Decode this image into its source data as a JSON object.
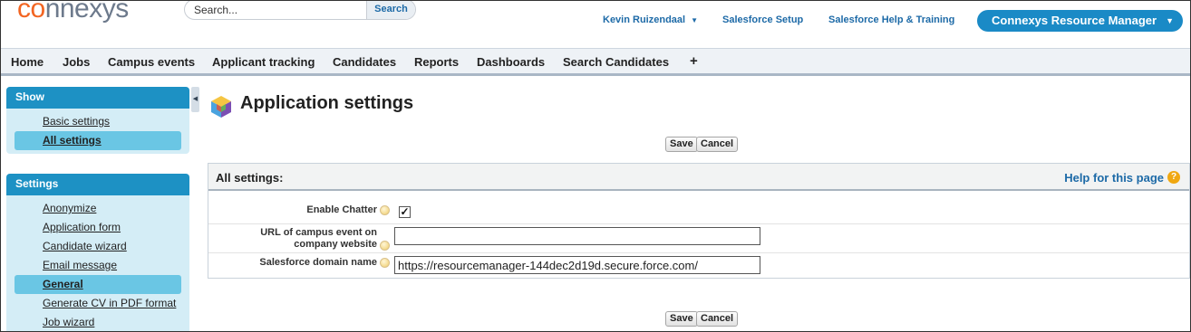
{
  "header": {
    "logo_accent": "co",
    "logo_rest": "nnexys",
    "search": {
      "value": "Search...",
      "button_label": "Search"
    },
    "user_menu": "Kevin Ruizendaal",
    "setup_link": "Salesforce Setup",
    "help_link": "Salesforce Help & Training",
    "app_menu": "Connexys Resource Manager"
  },
  "tabs": [
    {
      "label": "Home"
    },
    {
      "label": "Jobs"
    },
    {
      "label": "Campus events"
    },
    {
      "label": "Applicant tracking"
    },
    {
      "label": "Candidates"
    },
    {
      "label": "Reports"
    },
    {
      "label": "Dashboards"
    },
    {
      "label": "Search Candidates"
    },
    {
      "label": "+"
    }
  ],
  "sidebar": {
    "show": {
      "title": "Show",
      "items": [
        {
          "label": "Basic settings",
          "active": false
        },
        {
          "label": "All settings",
          "active": true
        }
      ]
    },
    "settings": {
      "title": "Settings",
      "items": [
        {
          "label": "Anonymize",
          "active": false
        },
        {
          "label": "Application form",
          "active": false
        },
        {
          "label": "Candidate wizard",
          "active": false
        },
        {
          "label": "Email message",
          "active": false
        },
        {
          "label": "General",
          "active": true
        },
        {
          "label": "Generate CV in PDF format",
          "active": false
        },
        {
          "label": "Job wizard",
          "active": false
        }
      ]
    }
  },
  "main": {
    "title": "Application settings",
    "save_label": "Save",
    "cancel_label": "Cancel",
    "panel": {
      "title": "All settings:",
      "help_label": "Help for this page",
      "help_icon": "?",
      "fields": {
        "enable_chatter": {
          "label": "Enable Chatter",
          "checked": true
        },
        "campus_url": {
          "label_line1": "URL of campus event on",
          "label_line2": "company website",
          "value": ""
        },
        "domain": {
          "label": "Salesforce domain name",
          "value": "https://resourcemanager-144dec2d19d.secure.force.com/"
        }
      }
    }
  },
  "colors": {
    "accent_blue": "#1d91c4",
    "link_blue": "#1d6aa7",
    "active_item": "#6ac6e4",
    "logo_orange": "#f26522"
  }
}
